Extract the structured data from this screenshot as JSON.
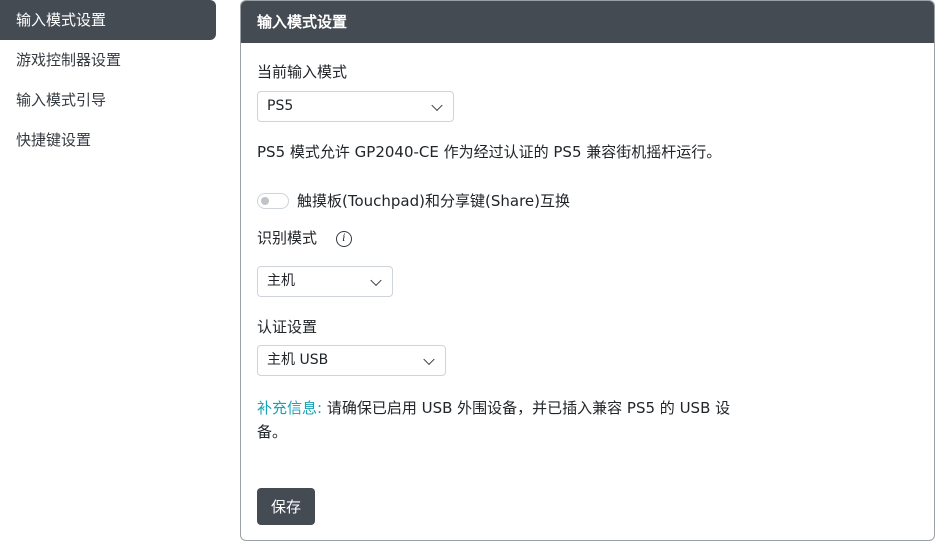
{
  "sidebar": {
    "items": [
      {
        "label": "输入模式设置"
      },
      {
        "label": "游戏控制器设置"
      },
      {
        "label": "输入模式引导"
      },
      {
        "label": "快捷键设置"
      }
    ]
  },
  "card": {
    "title": "输入模式设置",
    "current_mode_label": "当前输入模式",
    "current_mode_value": "PS5",
    "mode_description": "PS5 模式允许 GP2040-CE 作为经过认证的 PS5 兼容街机摇杆运行。",
    "toggle_label": "触摸板(Touchpad)和分享键(Share)互换",
    "toggle_on": false,
    "identify_label": "识别模式",
    "identify_value": "主机",
    "auth_label": "认证设置",
    "auth_value": "主机 USB",
    "note_prefix": "补充信息:",
    "note_text": " 请确保已启用 USB 外围设备，并已插入兼容 PS5 的 USB 设备。",
    "save_label": "保存"
  },
  "icons": {
    "info": "info-circle-icon",
    "dropdown": "chevron-down-icon"
  },
  "colors": {
    "header_bg": "#454b53",
    "accent_note": "#17a2b8"
  }
}
